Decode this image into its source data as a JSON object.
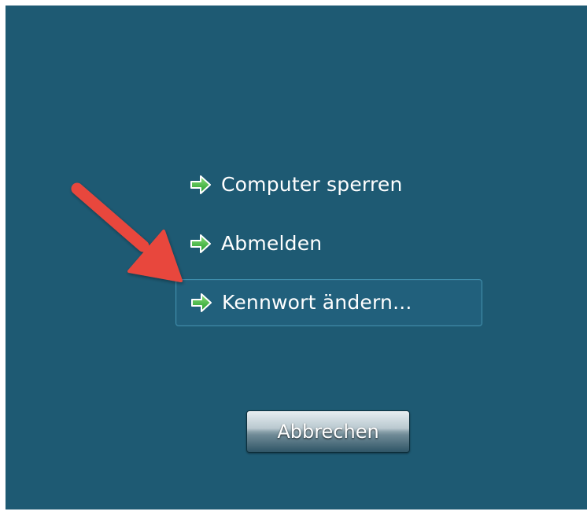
{
  "menu": {
    "items": [
      {
        "label": "Computer sperren",
        "icon": "green-arrow-icon"
      },
      {
        "label": "Abmelden",
        "icon": "green-arrow-icon"
      },
      {
        "label": "Kennwort ändern...",
        "icon": "green-arrow-icon",
        "selected": true
      }
    ]
  },
  "cancel_button": {
    "label": "Abbrechen"
  },
  "colors": {
    "background": "#1e5a73",
    "highlight_border": "#3f8eac",
    "icon_green": "#3ab53a",
    "annotation_arrow": "#e8473c"
  }
}
